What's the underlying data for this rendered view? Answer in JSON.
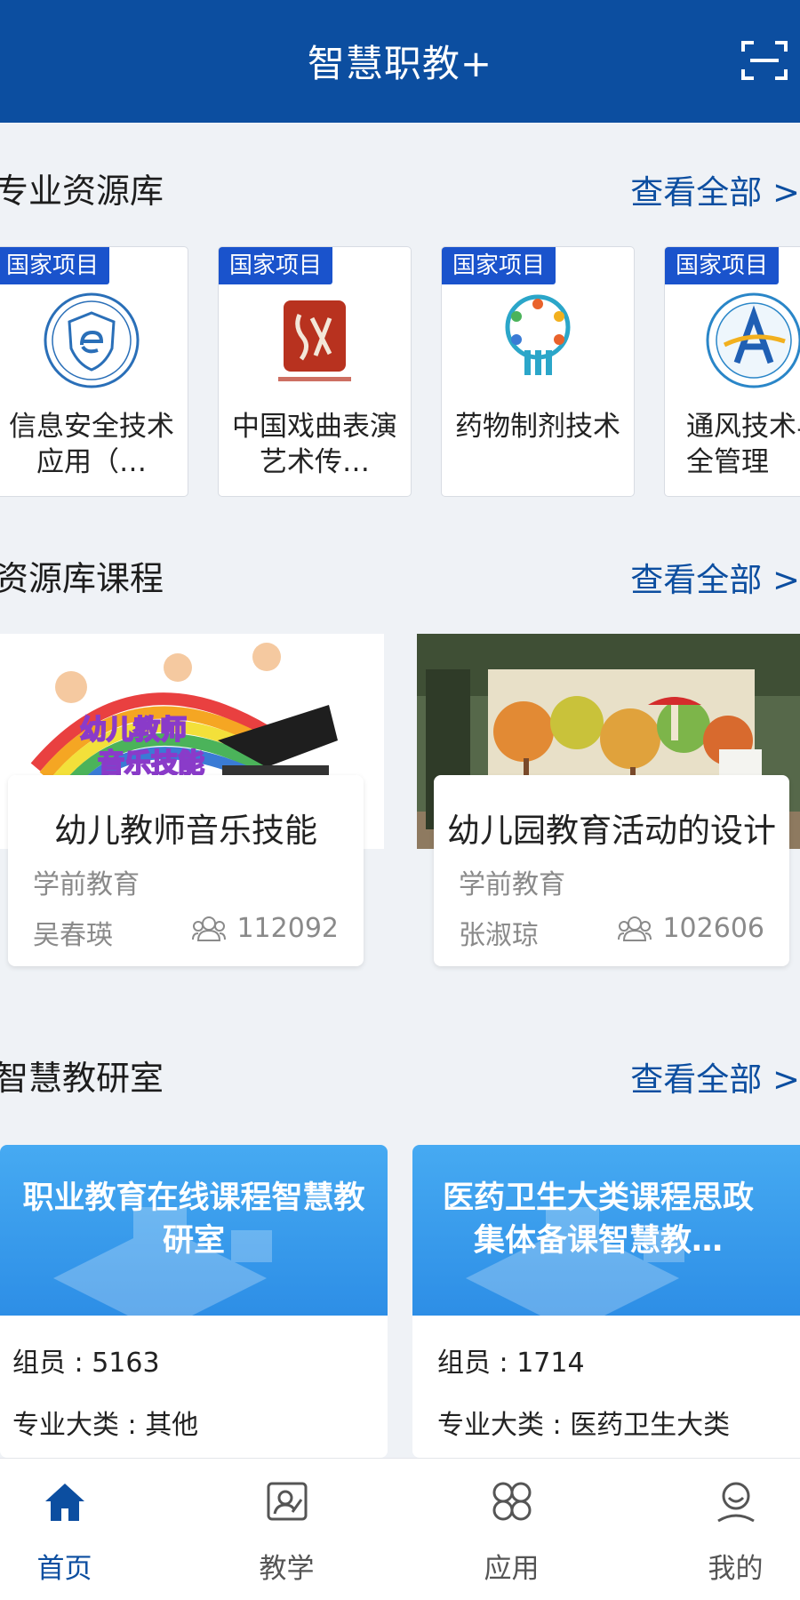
{
  "header": {
    "title": "智慧职教+",
    "scan_icon": "scan-icon"
  },
  "sections": {
    "resources": {
      "title": "专业资源库",
      "view_all": "查看全部 >"
    },
    "courses": {
      "title": "资源库课程",
      "view_all": "查看全部 >"
    },
    "labs": {
      "title": "智慧教研室",
      "view_all": "查看全部 >"
    }
  },
  "resources": [
    {
      "badge": "国家项目",
      "name": "信息安全技术应用（…",
      "logo": "shield-e-logo"
    },
    {
      "badge": "国家项目",
      "name": "中国戏曲表演艺术传…",
      "logo": "red-seal-logo"
    },
    {
      "badge": "国家项目",
      "name": "药物制剂技术",
      "logo": "pharma-logo"
    },
    {
      "badge": "国家项目",
      "name": "通风技术与安全管理",
      "logo": "ventilation-logo"
    }
  ],
  "courses": [
    {
      "title": "幼儿教师音乐技能",
      "category": "学前教育",
      "teacher": "吴春瑛",
      "count": "112092",
      "image_text_1": "幼儿教师",
      "image_text_2": "音乐技能"
    },
    {
      "title": "幼儿园教育活动的设计",
      "category": "学前教育",
      "teacher": "张淑琼",
      "count": "102606"
    }
  ],
  "labs": [
    {
      "title": "职业教育在线课程智慧教研室",
      "members_label": "组员 : ",
      "members": "5163",
      "category_label": "专业大类 : ",
      "category": "其他"
    },
    {
      "title": "医药卫生大类课程思政集体备课智慧教…",
      "members_label": "组员 : ",
      "members": "1714",
      "category_label": "专业大类 : ",
      "category": "医药卫生大类"
    }
  ],
  "tabbar": [
    {
      "label": "首页",
      "icon": "home-icon",
      "active": true
    },
    {
      "label": "教学",
      "icon": "teach-icon",
      "active": false
    },
    {
      "label": "应用",
      "icon": "apps-icon",
      "active": false
    },
    {
      "label": "我的",
      "icon": "user-icon",
      "active": false
    }
  ],
  "colors": {
    "brand": "#0c4ea0",
    "badge": "#1a53cc",
    "background": "#eff2f6",
    "lab_banner": "#3a9ded"
  }
}
